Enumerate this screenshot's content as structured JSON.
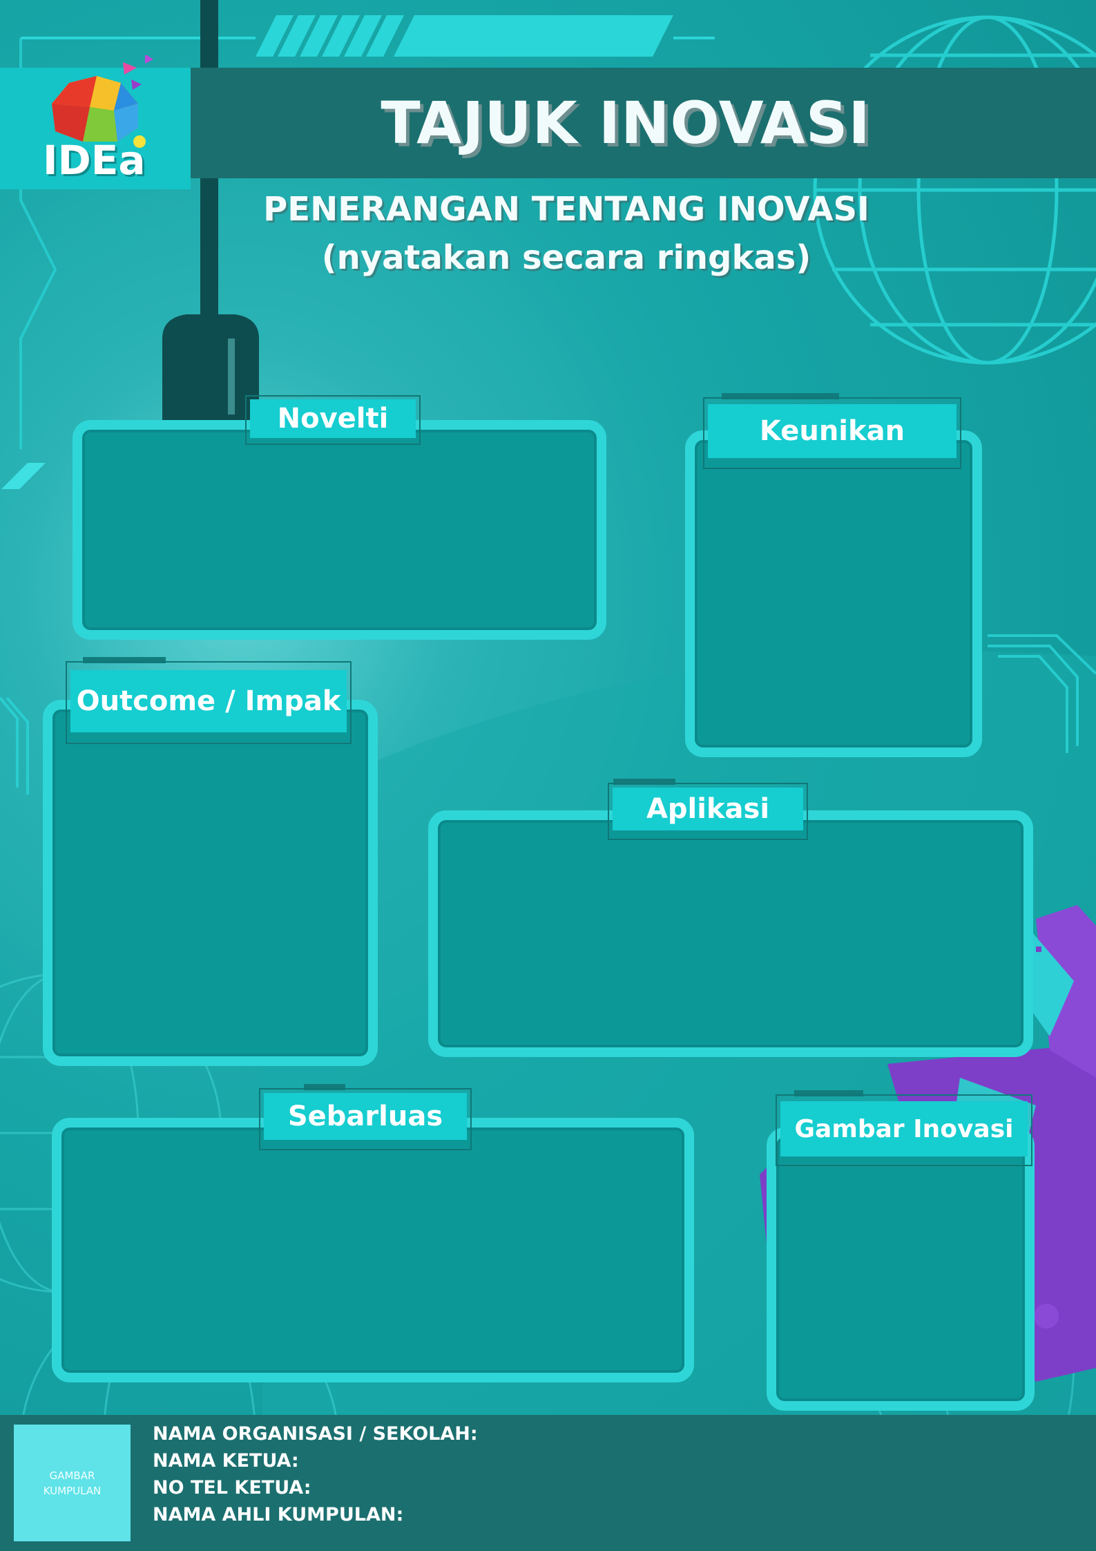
{
  "header": {
    "logo_text": "IDEa",
    "title": "TAJUK INOVASI",
    "subtitle_line1": "PENERANGAN TENTANG INOVASI",
    "subtitle_line2": "(nyatakan secara ringkas)"
  },
  "sections": {
    "novelti": "Novelti",
    "keunikan": "Keunikan",
    "outcome": "Outcome / Impak",
    "aplikasi": "Aplikasi",
    "sebarluas": "Sebarluas",
    "gambar": "Gambar Inovasi"
  },
  "footer": {
    "photo_line1": "GAMBAR",
    "photo_line2": "KUMPULAN",
    "org_label": "NAMA ORGANISASI / SEKOLAH:",
    "leader_label": "NAMA KETUA:",
    "phone_label": "NO TEL KETUA:",
    "members_label": "NAMA AHLI KUMPULAN:"
  },
  "colors": {
    "background": "#139c9d",
    "panel_border": "#2fd6d8",
    "panel_fill": "#0d9898",
    "header_bar": "#1b6f6f",
    "tab": "#16cdd0",
    "accent_purple": "#7d3fc8"
  }
}
